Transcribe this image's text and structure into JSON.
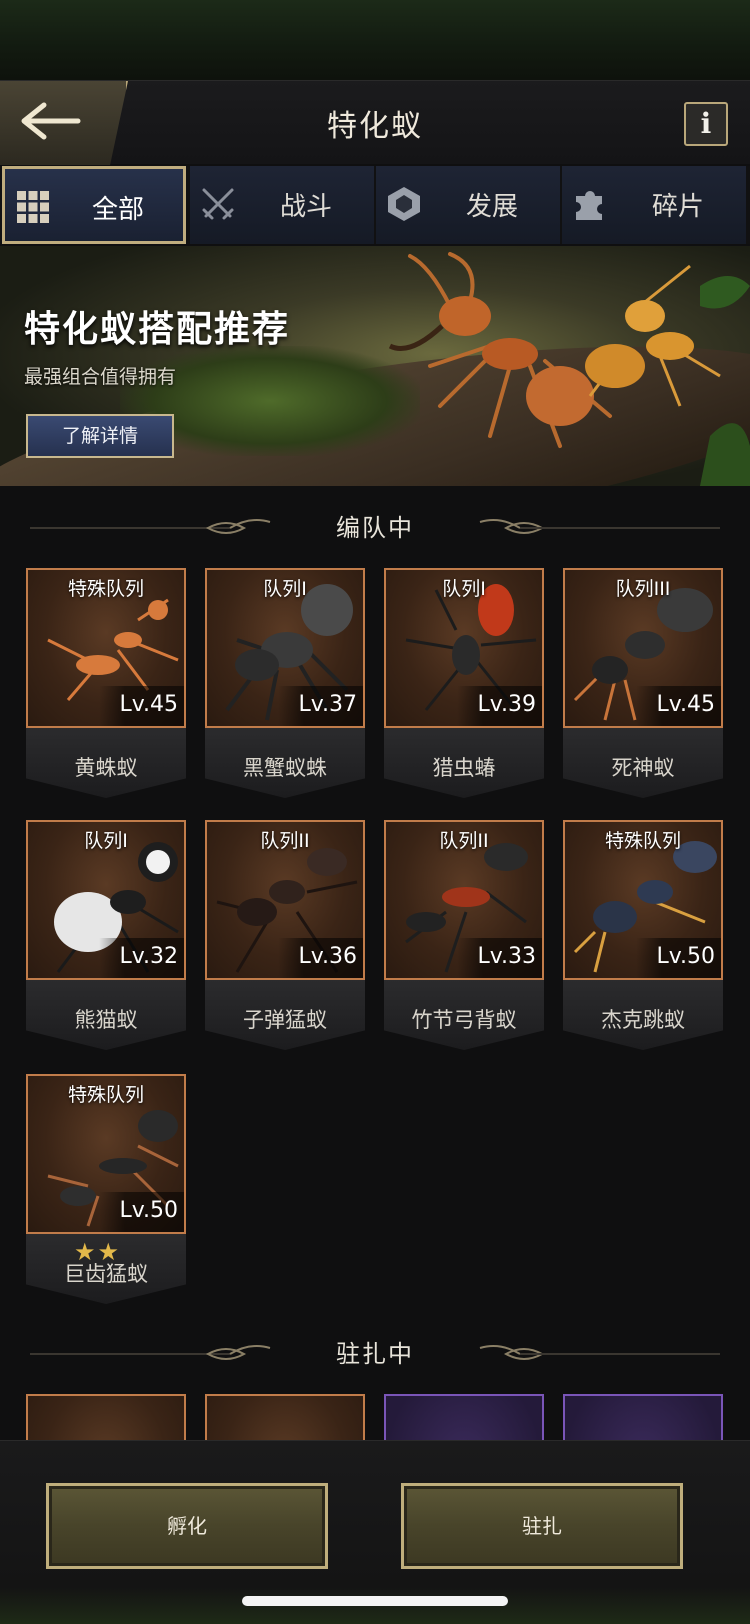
{
  "header": {
    "title": "特化蚁",
    "info_label": "i"
  },
  "tabs": [
    {
      "label": "全部",
      "icon": "grid-icon",
      "active": true
    },
    {
      "label": "战斗",
      "icon": "crossed-swords-icon",
      "active": false
    },
    {
      "label": "发展",
      "icon": "development-icon",
      "active": false
    },
    {
      "label": "碎片",
      "icon": "puzzle-piece-icon",
      "active": false
    }
  ],
  "banner": {
    "title": "特化蚁搭配推荐",
    "subtitle": "最强组合值得拥有",
    "button_label": "了解详情"
  },
  "sections": {
    "in_squad": "编队中",
    "stationed": "驻扎中"
  },
  "in_squad_cards": [
    {
      "squad": "特殊队列",
      "level": "Lv.45",
      "name": "黄蛛蚁"
    },
    {
      "squad": "队列I",
      "level": "Lv.37",
      "name": "黑蟹蚁蛛"
    },
    {
      "squad": "队列I",
      "level": "Lv.39",
      "name": "猎虫蝽"
    },
    {
      "squad": "队列III",
      "level": "Lv.45",
      "name": "死神蚁"
    },
    {
      "squad": "队列I",
      "level": "Lv.32",
      "name": "熊猫蚁"
    },
    {
      "squad": "队列II",
      "level": "Lv.36",
      "name": "子弹猛蚁"
    },
    {
      "squad": "队列II",
      "level": "Lv.33",
      "name": "竹节弓背蚁"
    },
    {
      "squad": "特殊队列",
      "level": "Lv.50",
      "name": "杰克跳蚁"
    },
    {
      "squad": "特殊队列",
      "level": "Lv.50",
      "name": "巨齿猛蚁",
      "stars": "★★"
    }
  ],
  "bottom": {
    "hatch_label": "孵化",
    "station_label": "驻扎"
  },
  "colors": {
    "gold_border": "#c0ad7f",
    "card_border": "#c17c4a",
    "purple_border": "#7a55b8"
  }
}
